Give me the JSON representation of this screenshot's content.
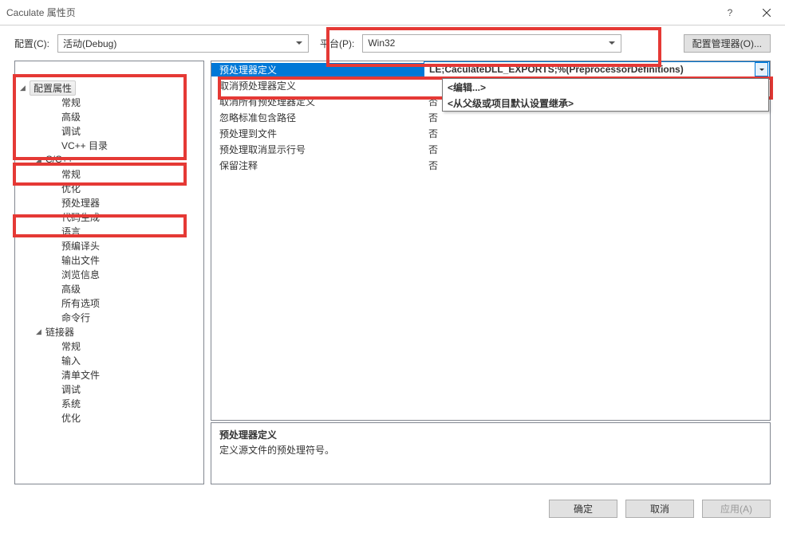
{
  "window": {
    "title": "Caculate 属性页"
  },
  "toolbar": {
    "config_label": "配置(C):",
    "config_value": "活动(Debug)",
    "platform_label": "平台(P):",
    "platform_value": "Win32",
    "config_mgr": "配置管理器(O)..."
  },
  "tree": {
    "root_label": "配置属性",
    "items_top": [
      "常规",
      "高级",
      "调试",
      "VC++ 目录"
    ],
    "cpp_label": "C/C++",
    "cpp_items": [
      "常规",
      "优化",
      "预处理器",
      "代码生成",
      "语言",
      "预编译头",
      "输出文件",
      "浏览信息",
      "高级",
      "所有选项",
      "命令行"
    ],
    "linker_label": "链接器",
    "linker_items": [
      "常规",
      "输入",
      "清单文件",
      "调试",
      "系统",
      "优化"
    ]
  },
  "grid": {
    "rows": [
      {
        "label": "预处理器定义",
        "value": "LE;CaculateDLL_EXPORTS;%(PreprocessorDefinitions)",
        "selected": true
      },
      {
        "label": "取消预处理器定义",
        "value": ""
      },
      {
        "label": "取消所有预处理器定义",
        "value": "否"
      },
      {
        "label": "忽略标准包含路径",
        "value": "否"
      },
      {
        "label": "预处理到文件",
        "value": "否"
      },
      {
        "label": "预处理取消显示行号",
        "value": "否"
      },
      {
        "label": "保留注释",
        "value": "否"
      }
    ],
    "popup": {
      "edit": "<编辑...>",
      "inherit": "<从父级或项目默认设置继承>"
    }
  },
  "desc": {
    "title": "预处理器定义",
    "body": "定义源文件的预处理符号。"
  },
  "footer": {
    "ok": "确定",
    "cancel": "取消",
    "apply": "应用(A)"
  },
  "watermark": ""
}
